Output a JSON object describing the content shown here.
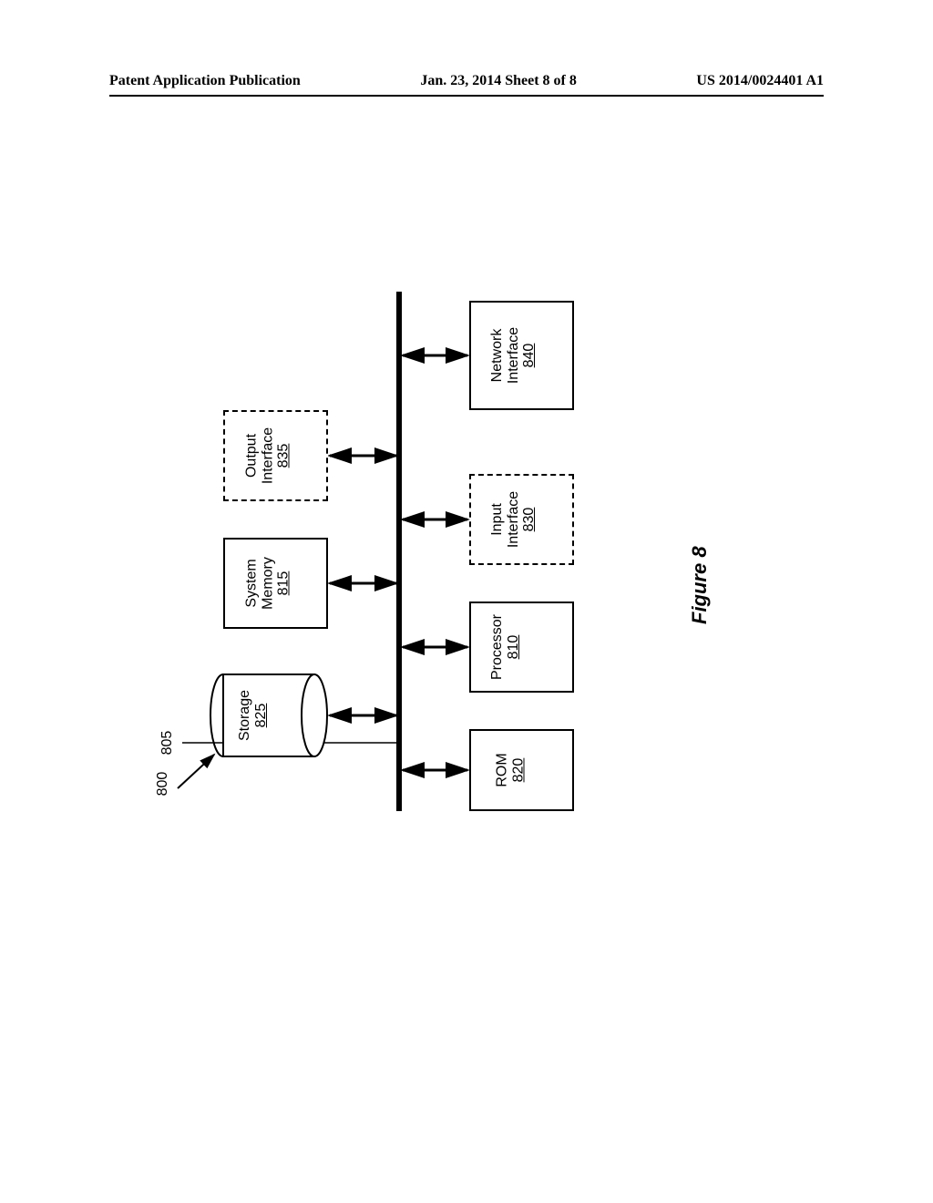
{
  "header": {
    "left": "Patent Application Publication",
    "center": "Jan. 23, 2014  Sheet 8 of 8",
    "right": "US 2014/0024401 A1"
  },
  "diagram": {
    "system_label": "800",
    "bus_label": "805",
    "storage": {
      "name": "Storage",
      "num": "825"
    },
    "sysmem": {
      "name": "System Memory",
      "num": "815"
    },
    "output": {
      "name": "Output Interface",
      "num": "835"
    },
    "rom": {
      "name": "ROM",
      "num": "820"
    },
    "proc": {
      "name": "Processor",
      "num": "810"
    },
    "input": {
      "name": "Input Interface",
      "num": "830"
    },
    "net": {
      "name": "Network Interface",
      "num": "840"
    }
  },
  "figure_caption": "Figure 8"
}
